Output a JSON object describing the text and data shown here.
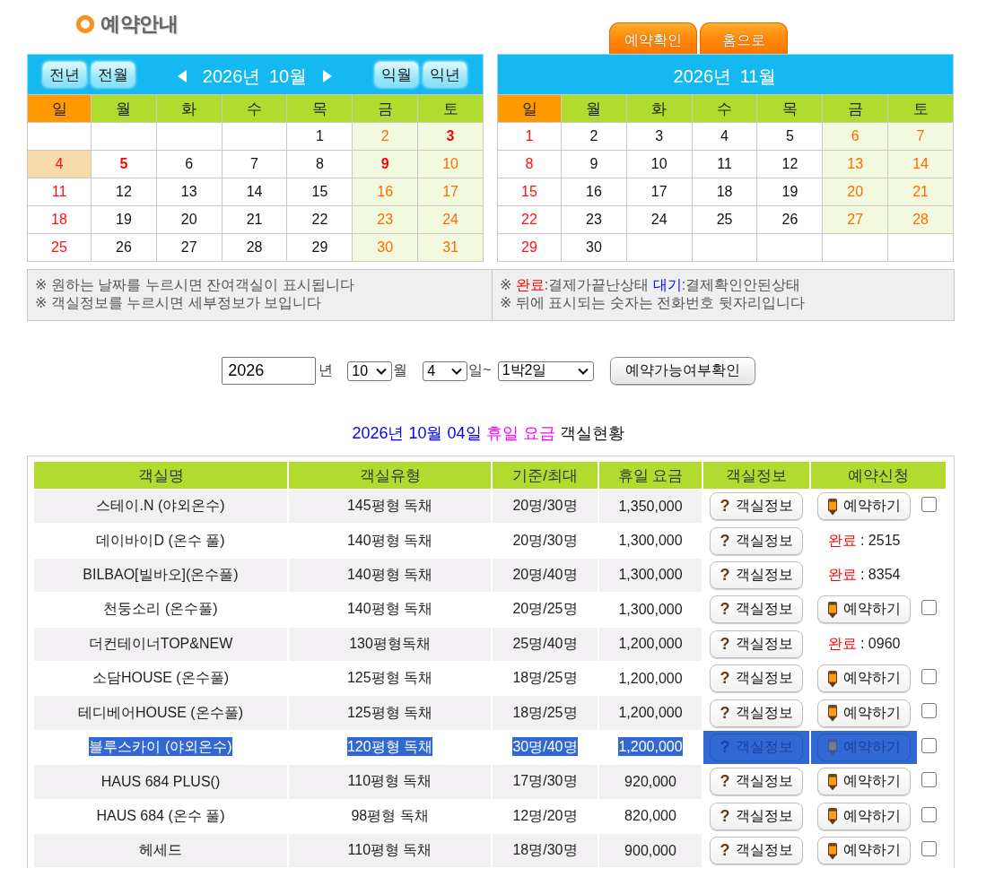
{
  "header": {
    "title": "예약안내",
    "tabs": [
      {
        "label": "예약확인"
      },
      {
        "label": "홈으로"
      }
    ]
  },
  "calendars": [
    {
      "title": "2026년 10월",
      "nav": {
        "prev_year": "전년",
        "prev_month": "전월",
        "next_month": "익월",
        "next_year": "익년"
      },
      "weekdays": [
        {
          "label": "일",
          "kind": "sunday"
        },
        {
          "label": "월",
          "kind": "weekday"
        },
        {
          "label": "화",
          "kind": "weekday"
        },
        {
          "label": "수",
          "kind": "weekday"
        },
        {
          "label": "목",
          "kind": "weekday"
        },
        {
          "label": "금",
          "kind": "weekend"
        },
        {
          "label": "토",
          "kind": "weekend"
        }
      ],
      "weeks": [
        [
          {
            "label": "1",
            "holiday": false,
            "selected": false
          },
          {
            "label": "2",
            "holiday": false,
            "selected": false
          },
          {
            "label": "3",
            "holiday": true,
            "selected": false
          }
        ],
        [
          {
            "label": "4",
            "holiday": false,
            "selected": true
          },
          {
            "label": "5",
            "holiday": true,
            "selected": false
          },
          {
            "label": "6",
            "holiday": false,
            "selected": false
          },
          {
            "label": "7",
            "holiday": false,
            "selected": false
          },
          {
            "label": "8",
            "holiday": false,
            "selected": false
          },
          {
            "label": "9",
            "holiday": true,
            "selected": false
          },
          {
            "label": "10",
            "holiday": false,
            "selected": false
          }
        ],
        [
          {
            "label": "11",
            "holiday": false,
            "selected": false
          },
          {
            "label": "12",
            "holiday": false,
            "selected": false
          },
          {
            "label": "13",
            "holiday": false,
            "selected": false
          },
          {
            "label": "14",
            "holiday": false,
            "selected": false
          },
          {
            "label": "15",
            "holiday": false,
            "selected": false
          },
          {
            "label": "16",
            "holiday": false,
            "selected": false
          },
          {
            "label": "17",
            "holiday": false,
            "selected": false
          }
        ],
        [
          {
            "label": "18",
            "holiday": false,
            "selected": false
          },
          {
            "label": "19",
            "holiday": false,
            "selected": false
          },
          {
            "label": "20",
            "holiday": false,
            "selected": false
          },
          {
            "label": "21",
            "holiday": false,
            "selected": false
          },
          {
            "label": "22",
            "holiday": false,
            "selected": false
          },
          {
            "label": "23",
            "holiday": false,
            "selected": false
          },
          {
            "label": "24",
            "holiday": false,
            "selected": false
          }
        ],
        [
          {
            "label": "25",
            "holiday": false,
            "selected": false
          },
          {
            "label": "26",
            "holiday": false,
            "selected": false
          },
          {
            "label": "27",
            "holiday": false,
            "selected": false
          },
          {
            "label": "28",
            "holiday": false,
            "selected": false
          },
          {
            "label": "29",
            "holiday": false,
            "selected": false
          },
          {
            "label": "30",
            "holiday": false,
            "selected": false
          },
          {
            "label": "31",
            "holiday": false,
            "selected": false
          }
        ]
      ]
    },
    {
      "title": "2026년 11월",
      "weekdays": [
        {
          "label": "일",
          "kind": "sunday"
        },
        {
          "label": "월",
          "kind": "weekday"
        },
        {
          "label": "화",
          "kind": "weekday"
        },
        {
          "label": "수",
          "kind": "weekday"
        },
        {
          "label": "목",
          "kind": "weekday"
        },
        {
          "label": "금",
          "kind": "weekend"
        },
        {
          "label": "토",
          "kind": "weekend"
        }
      ],
      "weeks": [
        [
          {
            "label": "1",
            "holiday": false,
            "selected": false
          },
          {
            "label": "2",
            "holiday": false,
            "selected": false
          },
          {
            "label": "3",
            "holiday": false,
            "selected": false
          },
          {
            "label": "4",
            "holiday": false,
            "selected": false
          },
          {
            "label": "5",
            "holiday": false,
            "selected": false
          },
          {
            "label": "6",
            "holiday": false,
            "selected": false
          },
          {
            "label": "7",
            "holiday": false,
            "selected": false
          }
        ],
        [
          {
            "label": "8",
            "holiday": false,
            "selected": false
          },
          {
            "label": "9",
            "holiday": false,
            "selected": false
          },
          {
            "label": "10",
            "holiday": false,
            "selected": false
          },
          {
            "label": "11",
            "holiday": false,
            "selected": false
          },
          {
            "label": "12",
            "holiday": false,
            "selected": false
          },
          {
            "label": "13",
            "holiday": false,
            "selected": false
          },
          {
            "label": "14",
            "holiday": false,
            "selected": false
          }
        ],
        [
          {
            "label": "15",
            "holiday": false,
            "selected": false
          },
          {
            "label": "16",
            "holiday": false,
            "selected": false
          },
          {
            "label": "17",
            "holiday": false,
            "selected": false
          },
          {
            "label": "18",
            "holiday": false,
            "selected": false
          },
          {
            "label": "19",
            "holiday": false,
            "selected": false
          },
          {
            "label": "20",
            "holiday": false,
            "selected": false
          },
          {
            "label": "21",
            "holiday": false,
            "selected": false
          }
        ],
        [
          {
            "label": "22",
            "holiday": false,
            "selected": false
          },
          {
            "label": "23",
            "holiday": false,
            "selected": false
          },
          {
            "label": "24",
            "holiday": false,
            "selected": false
          },
          {
            "label": "25",
            "holiday": false,
            "selected": false
          },
          {
            "label": "26",
            "holiday": false,
            "selected": false
          },
          {
            "label": "27",
            "holiday": false,
            "selected": false
          },
          {
            "label": "28",
            "holiday": false,
            "selected": false
          }
        ],
        [
          {
            "label": "29",
            "holiday": false,
            "selected": false
          },
          {
            "label": "30",
            "holiday": false,
            "selected": false
          }
        ]
      ]
    }
  ],
  "notes": {
    "left": [
      {
        "kind": "text",
        "text": "※ 원하는 날짜를 누르시면 잔여객실이 표시됩니다"
      },
      {
        "kind": "text",
        "text": "※ 객실정보를 누르시면 세부정보가 보입니다"
      }
    ],
    "right": [
      {
        "kind": "legend",
        "marker": "※",
        "items": [
          {
            "kind": "done",
            "label": "완료",
            "text": ":결제가끝난상태"
          },
          {
            "kind": "waiting",
            "label": "대기",
            "text": ":결제확인안된상태"
          }
        ]
      },
      {
        "kind": "text",
        "text": "※ 뒤에 표시되는 숫자는 전화번호 뒷자리입니다"
      }
    ]
  },
  "search_form": {
    "year": "2026",
    "year_unit": "년",
    "month": "10",
    "month_unit": "월",
    "day": "4",
    "day_unit": "일~",
    "stay": "1박2일",
    "submit": "예약가능여부확인"
  },
  "status_heading": {
    "date": "2026년 10월 04일",
    "rate_type": "휴일 요금",
    "suffix": "객실현황"
  },
  "rooms_table": {
    "columns": [
      "객실명",
      "객실유형",
      "기준/최대",
      "휴일 요금",
      "객실정보",
      "예약신청"
    ],
    "rows": [
      {
        "name": "스테이.N (야외온수)",
        "type": "145평형 독채",
        "capacity": "20명/30명",
        "price": "1,350,000",
        "info": {
          "icon": "?",
          "label": "객실정보"
        },
        "booking": {
          "kind": "button",
          "label": "예약하기",
          "checked": false
        },
        "selected": false
      },
      {
        "name": "데이바이D (온수 풀)",
        "type": "140평형 독채",
        "capacity": "20명/30명",
        "price": "1,300,000",
        "info": {
          "icon": "?",
          "label": "객실정보"
        },
        "booking": {
          "kind": "status",
          "label": "완료",
          "detail": ": 2515"
        },
        "selected": false
      },
      {
        "name": "BILBAO[빌바오](온수풀)",
        "type": "140평형 독채",
        "capacity": "20명/40명",
        "price": "1,300,000",
        "info": {
          "icon": "?",
          "label": "객실정보"
        },
        "booking": {
          "kind": "status",
          "label": "완료",
          "detail": ": 8354"
        },
        "selected": false
      },
      {
        "name": "천둥소리 (온수풀)",
        "type": "140평형 독채",
        "capacity": "20명/25명",
        "price": "1,300,000",
        "info": {
          "icon": "?",
          "label": "객실정보"
        },
        "booking": {
          "kind": "button",
          "label": "예약하기",
          "checked": false
        },
        "selected": false
      },
      {
        "name": "더컨테이너TOP&NEW",
        "type": "130평형독채",
        "capacity": "25명/40명",
        "price": "1,200,000",
        "info": {
          "icon": "?",
          "label": "객실정보"
        },
        "booking": {
          "kind": "status",
          "label": "완료",
          "detail": ": 0960"
        },
        "selected": false
      },
      {
        "name": "소담HOUSE (온수풀)",
        "type": "125평형 독채",
        "capacity": "18명/25명",
        "price": "1,200,000",
        "info": {
          "icon": "?",
          "label": "객실정보"
        },
        "booking": {
          "kind": "button",
          "label": "예약하기",
          "checked": false
        },
        "selected": false
      },
      {
        "name": "테디베어HOUSE (온수풀)",
        "type": "125평형 독채",
        "capacity": "18명/25명",
        "price": "1,200,000",
        "info": {
          "icon": "?",
          "label": "객실정보"
        },
        "booking": {
          "kind": "button",
          "label": "예약하기",
          "checked": false
        },
        "selected": false
      },
      {
        "name": "블루스카이 (야외온수)",
        "type": "120평형 독채",
        "capacity": "30명/40명",
        "price": "1,200,000",
        "info": {
          "icon": "?",
          "label": "객실정보"
        },
        "booking": {
          "kind": "button",
          "label": "예약하기",
          "checked": false
        },
        "selected": true
      },
      {
        "name": "HAUS 684 PLUS()",
        "type": "110평형 독채",
        "capacity": "17명/30명",
        "price": "920,000",
        "info": {
          "icon": "?",
          "label": "객실정보"
        },
        "booking": {
          "kind": "button",
          "label": "예약하기",
          "checked": false
        },
        "selected": false
      },
      {
        "name": "HAUS 684 (온수 풀)",
        "type": "98평형 독채",
        "capacity": "12명/20명",
        "price": "820,000",
        "info": {
          "icon": "?",
          "label": "객실정보"
        },
        "booking": {
          "kind": "button",
          "label": "예약하기",
          "checked": false
        },
        "selected": false
      },
      {
        "name": "헤세드",
        "type": "110평형 독채",
        "capacity": "18명/30명",
        "price": "900,000",
        "info": {
          "icon": "?",
          "label": "객실정보"
        },
        "booking": {
          "kind": "button",
          "label": "예약하기",
          "checked": false
        },
        "selected": false
      }
    ]
  }
}
